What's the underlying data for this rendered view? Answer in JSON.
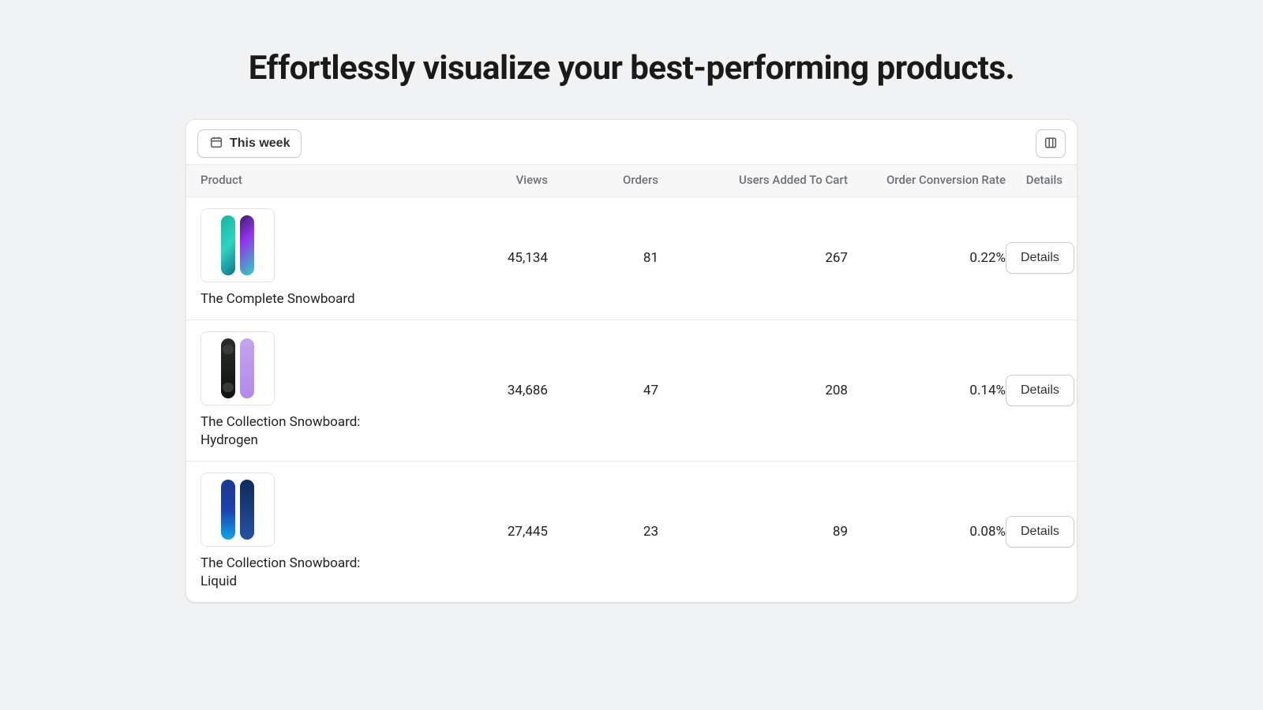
{
  "headline": "Effortlessly visualize your best-performing products.",
  "toolbar": {
    "date_range_label": "This week"
  },
  "columns": {
    "product": "Product",
    "views": "Views",
    "orders": "Orders",
    "added_to_cart": "Users Added To Cart",
    "conversion_rate": "Order Conversion Rate",
    "details": "Details"
  },
  "details_button_label": "Details",
  "products": [
    {
      "name": "The Complete Snowboard",
      "views": "45,134",
      "orders": "81",
      "added_to_cart": "267",
      "conversion_rate": "0.22%"
    },
    {
      "name": "The Collection Snowboard: Hydrogen",
      "views": "34,686",
      "orders": "47",
      "added_to_cart": "208",
      "conversion_rate": "0.14%"
    },
    {
      "name": "The Collection Snowboard: Liquid",
      "views": "27,445",
      "orders": "23",
      "added_to_cart": "89",
      "conversion_rate": "0.08%"
    }
  ]
}
